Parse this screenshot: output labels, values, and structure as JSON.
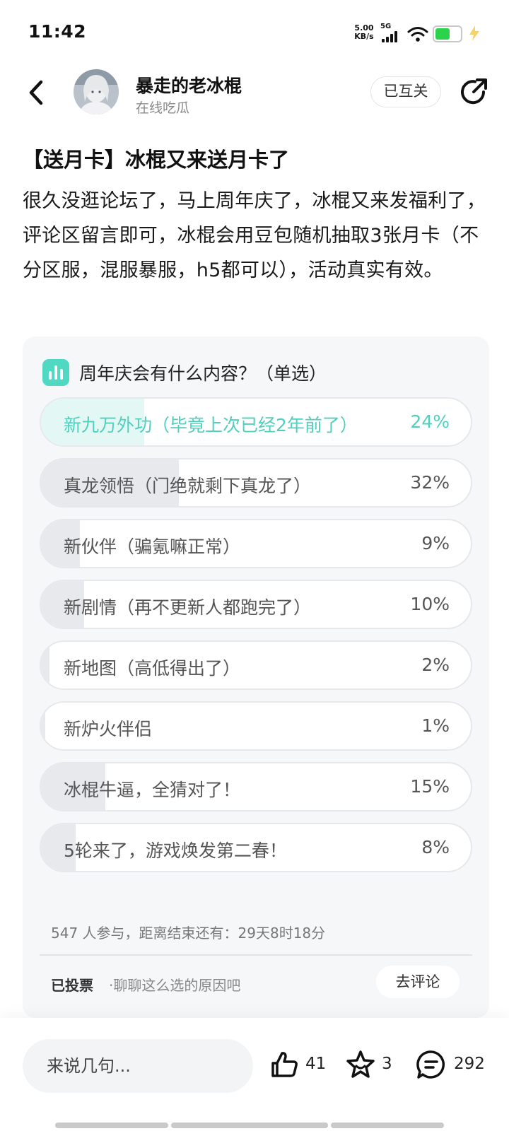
{
  "status_bar": {
    "time": "11:42",
    "net_speed_value": "5.00",
    "net_speed_unit": "KB/s",
    "network": "5G",
    "battery_color": "#2bd34a"
  },
  "header": {
    "back_icon": "chevron-left-icon",
    "author_name": "暴走的老冰棍",
    "author_subtitle": "在线吃瓜",
    "follow_label": "已互关",
    "share_icon": "share-icon"
  },
  "post": {
    "title": "【送月卡】冰棍又来送月卡了",
    "body": "很久没逛论坛了，马上周年庆了，冰棍又来发福利了，评论区留言即可，冰棍会用豆包随机抽取3张月卡（不分区服，混服暴服，h5都可以），活动真实有效。"
  },
  "poll": {
    "question": "周年庆会有什么内容？（单选）",
    "options": [
      {
        "label": "新九万外功（毕竟上次已经2年前了）",
        "percent": "24%",
        "fraction": 0.24,
        "selected": true
      },
      {
        "label": "真龙领悟（门绝就剩下真龙了）",
        "percent": "32%",
        "fraction": 0.32,
        "selected": false
      },
      {
        "label": "新伙伴（骗氪嘛正常）",
        "percent": "9%",
        "fraction": 0.09,
        "selected": false
      },
      {
        "label": "新剧情（再不更新人都跑完了）",
        "percent": "10%",
        "fraction": 0.1,
        "selected": false
      },
      {
        "label": "新地图（高低得出了）",
        "percent": "2%",
        "fraction": 0.02,
        "selected": false
      },
      {
        "label": "新炉火伴侣",
        "percent": "1%",
        "fraction": 0.01,
        "selected": false
      },
      {
        "label": "冰棍牛逼，全猜对了！",
        "percent": "15%",
        "fraction": 0.15,
        "selected": false
      },
      {
        "label": "5轮来了，游戏焕发第二春！",
        "percent": "8%",
        "fraction": 0.08,
        "selected": false
      }
    ],
    "footer": "547 人参与，距离结束还有：29天8时18分",
    "voted_label": "已投票",
    "voted_hint": "·聊聊这么选的原因吧",
    "comment_label": "去评论",
    "accent_color": "#4fd0bd"
  },
  "bottom_bar": {
    "input_placeholder": "来说几句...",
    "like_count": "41",
    "favorite_count": "3",
    "comment_count": "292"
  }
}
